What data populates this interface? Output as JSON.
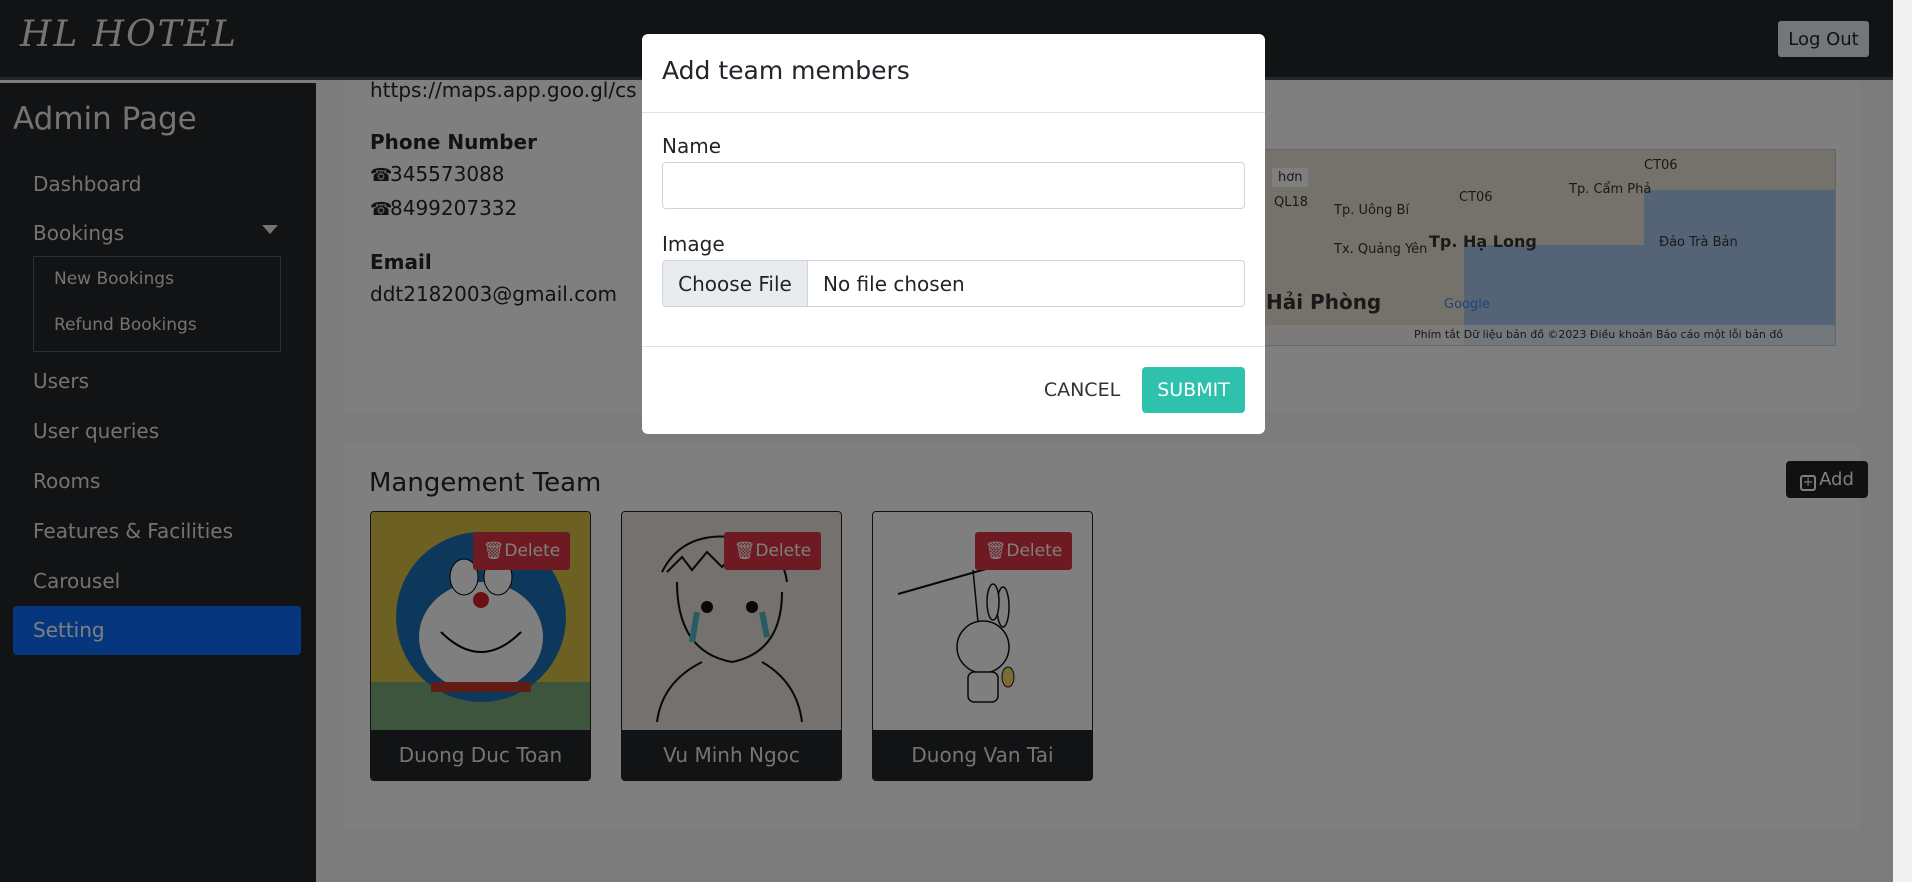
{
  "brand": "HL HOTEL",
  "header": {
    "logout_label": "Log Out"
  },
  "sidebar": {
    "title": "Admin Page",
    "items": {
      "dashboard": "Dashboard",
      "bookings": "Bookings",
      "new_bookings": "New Bookings",
      "refund_bookings": "Refund Bookings",
      "users": "Users",
      "user_queries": "User queries",
      "rooms": "Rooms",
      "features": "Features & Facilities",
      "carousel": "Carousel",
      "setting": "Setting"
    },
    "active": "Setting"
  },
  "contact": {
    "map_url": "https://maps.app.goo.gl/cs",
    "phone_label": "Phone Number",
    "phone1": "345573088",
    "phone2": "8499207332",
    "email_label": "Email",
    "email": "ddt2182003@gmail.com"
  },
  "map": {
    "labels": {
      "l1": "CT06",
      "l2": "Tp. Cẩm Phả",
      "l3": "QL18",
      "l4": "Tp. Uông Bí",
      "l5": "CT06",
      "l6": "Tx. Quảng Yên",
      "l7": "Tp. Hạ Long",
      "l8": "Đảo Trà Bản",
      "l9": "Hải Phòng",
      "l10": "Google",
      "l11": "hơn"
    },
    "footer": "Phím tắt   Dữ liệu bản đồ ©2023   Điều khoản   Báo cáo một lỗi bản đồ"
  },
  "team": {
    "title": "Mangement Team",
    "add_label": "Add",
    "delete_label": "Delete",
    "members": [
      {
        "name": "Duong Duc Toan"
      },
      {
        "name": "Vu Minh Ngoc"
      },
      {
        "name": "Duong Van Tai"
      }
    ]
  },
  "modal": {
    "title": "Add team members",
    "name_label": "Name",
    "name_value": "",
    "image_label": "Image",
    "file_button": "Choose File",
    "file_status": "No file chosen",
    "cancel_label": "CANCEL",
    "submit_label": "SUBMIT"
  },
  "colors": {
    "sidebar_bg": "#23262b",
    "active": "#0d6efd",
    "delete": "#dc3545",
    "submit": "#2ec1ac"
  }
}
